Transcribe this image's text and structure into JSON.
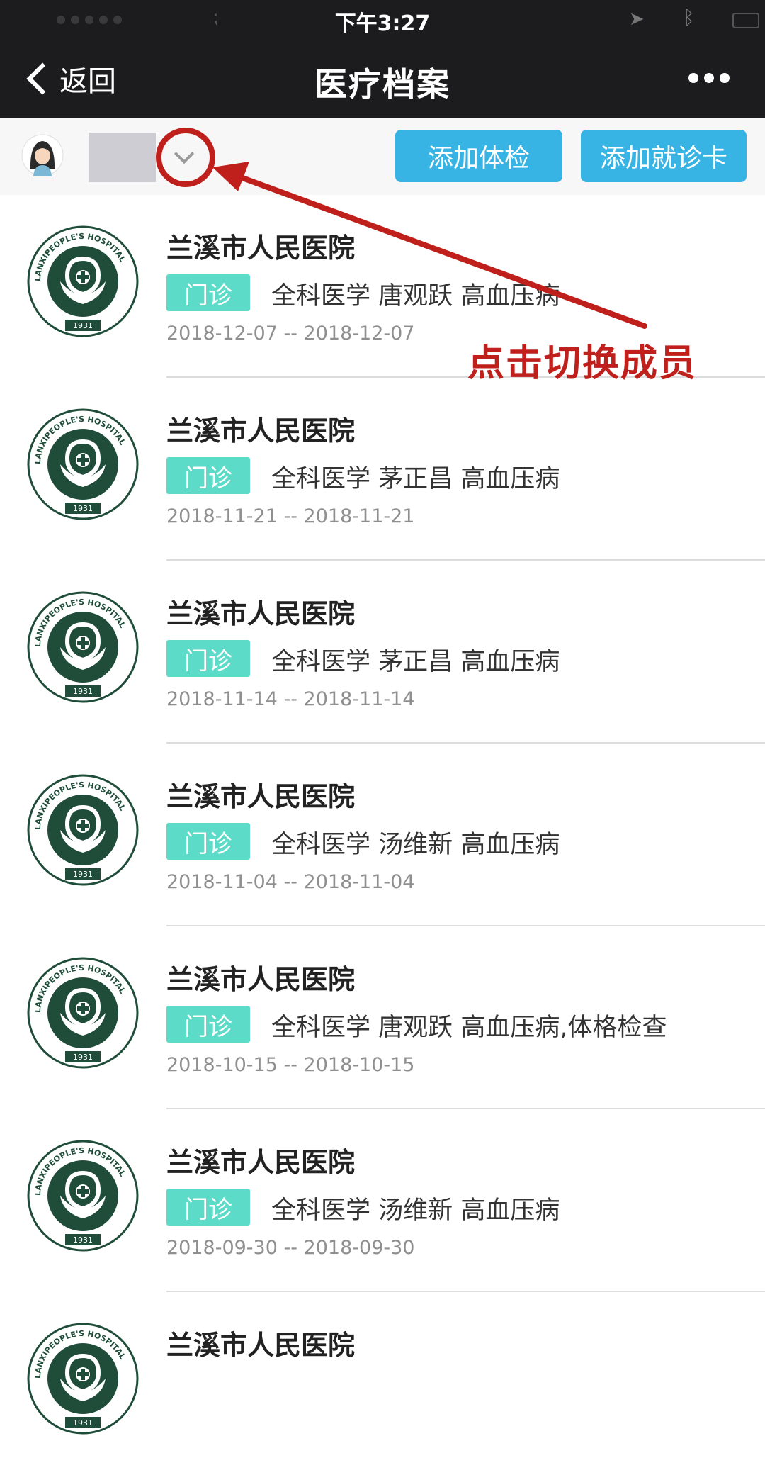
{
  "status_bar": {
    "time": "下午3:27"
  },
  "nav": {
    "back_label": "返回",
    "title": "医疗档案"
  },
  "member_bar": {
    "add_exam_label": "添加体检",
    "add_card_label": "添加就诊卡"
  },
  "records": [
    {
      "hospital": "兰溪市人民医院",
      "type": "门诊",
      "department": "全科医学",
      "doctor": "唐观跃",
      "diagnosis": "高血压病",
      "date_range": "2018-12-07 -- 2018-12-07"
    },
    {
      "hospital": "兰溪市人民医院",
      "type": "门诊",
      "department": "全科医学",
      "doctor": "茅正昌",
      "diagnosis": "高血压病",
      "date_range": "2018-11-21 -- 2018-11-21"
    },
    {
      "hospital": "兰溪市人民医院",
      "type": "门诊",
      "department": "全科医学",
      "doctor": "茅正昌",
      "diagnosis": "高血压病",
      "date_range": "2018-11-14 -- 2018-11-14"
    },
    {
      "hospital": "兰溪市人民医院",
      "type": "门诊",
      "department": "全科医学",
      "doctor": "汤维新",
      "diagnosis": "高血压病",
      "date_range": "2018-11-04 -- 2018-11-04"
    },
    {
      "hospital": "兰溪市人民医院",
      "type": "门诊",
      "department": "全科医学",
      "doctor": "唐观跃",
      "diagnosis": "高血压病,体格检查",
      "date_range": "2018-10-15 -- 2018-10-15"
    },
    {
      "hospital": "兰溪市人民医院",
      "type": "门诊",
      "department": "全科医学",
      "doctor": "汤维新",
      "diagnosis": "高血压病",
      "date_range": "2018-09-30 -- 2018-09-30"
    },
    {
      "hospital": "兰溪市人民医院"
    }
  ],
  "hospital_logo": {
    "ring_text": "LANXIPEOPLE'S HOSPITAL",
    "year": "1931",
    "color": "#1f4d3a"
  },
  "annotation": {
    "text": "点击切换成员",
    "color": "#c0201c"
  },
  "colors": {
    "nav_bg": "#1c1c1e",
    "button_blue": "#37b4e4",
    "tag_teal": "#5cdbc8"
  }
}
